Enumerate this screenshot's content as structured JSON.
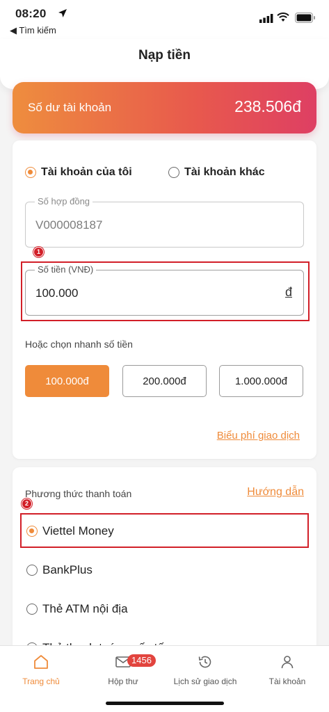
{
  "status_bar": {
    "time": "08:20",
    "back_app": "◀ Tìm kiếm"
  },
  "header": {
    "title": "Nạp tiền"
  },
  "balance": {
    "label": "Số dư tài khoản",
    "value": "238.506đ"
  },
  "account_options": [
    {
      "label": "Tài khoản của tôi",
      "selected": true
    },
    {
      "label": "Tài khoản khác",
      "selected": false
    }
  ],
  "contract_field": {
    "label": "Số hợp đồng",
    "value": "V000008187"
  },
  "amount_field": {
    "label": "Số tiền (VNĐ)",
    "value": "100.000",
    "suffix": "đ"
  },
  "quick_amount": {
    "label": "Hoặc chọn nhanh số tiền",
    "options": [
      "100.000đ",
      "200.000đ",
      "1.000.000đ"
    ],
    "selected_index": 0
  },
  "fee_link": "Biểu phí giao dịch",
  "payment": {
    "title": "Phương thức thanh toán",
    "guide_link": "Hướng dẫn",
    "methods": [
      {
        "label": "Viettel Money",
        "selected": true
      },
      {
        "label": "BankPlus",
        "selected": false
      },
      {
        "label": "Thẻ ATM nội địa",
        "selected": false
      },
      {
        "label": "Thẻ thanh toán quốc tế",
        "selected": false
      }
    ]
  },
  "annotations": [
    "1",
    "2"
  ],
  "bottom_nav": {
    "items": [
      {
        "label": "Trang chủ",
        "icon": "home-icon",
        "active": true
      },
      {
        "label": "Hộp thư",
        "icon": "mail-icon",
        "active": false,
        "badge": "1456"
      },
      {
        "label": "Lịch sử giao dịch",
        "icon": "history-icon",
        "active": false
      },
      {
        "label": "Tài khoản",
        "icon": "user-icon",
        "active": false
      }
    ]
  },
  "colors": {
    "accent": "#ef8b3a",
    "highlight": "#d21f28",
    "gradient_start": "#ee8d3e",
    "gradient_end": "#de3f63"
  }
}
